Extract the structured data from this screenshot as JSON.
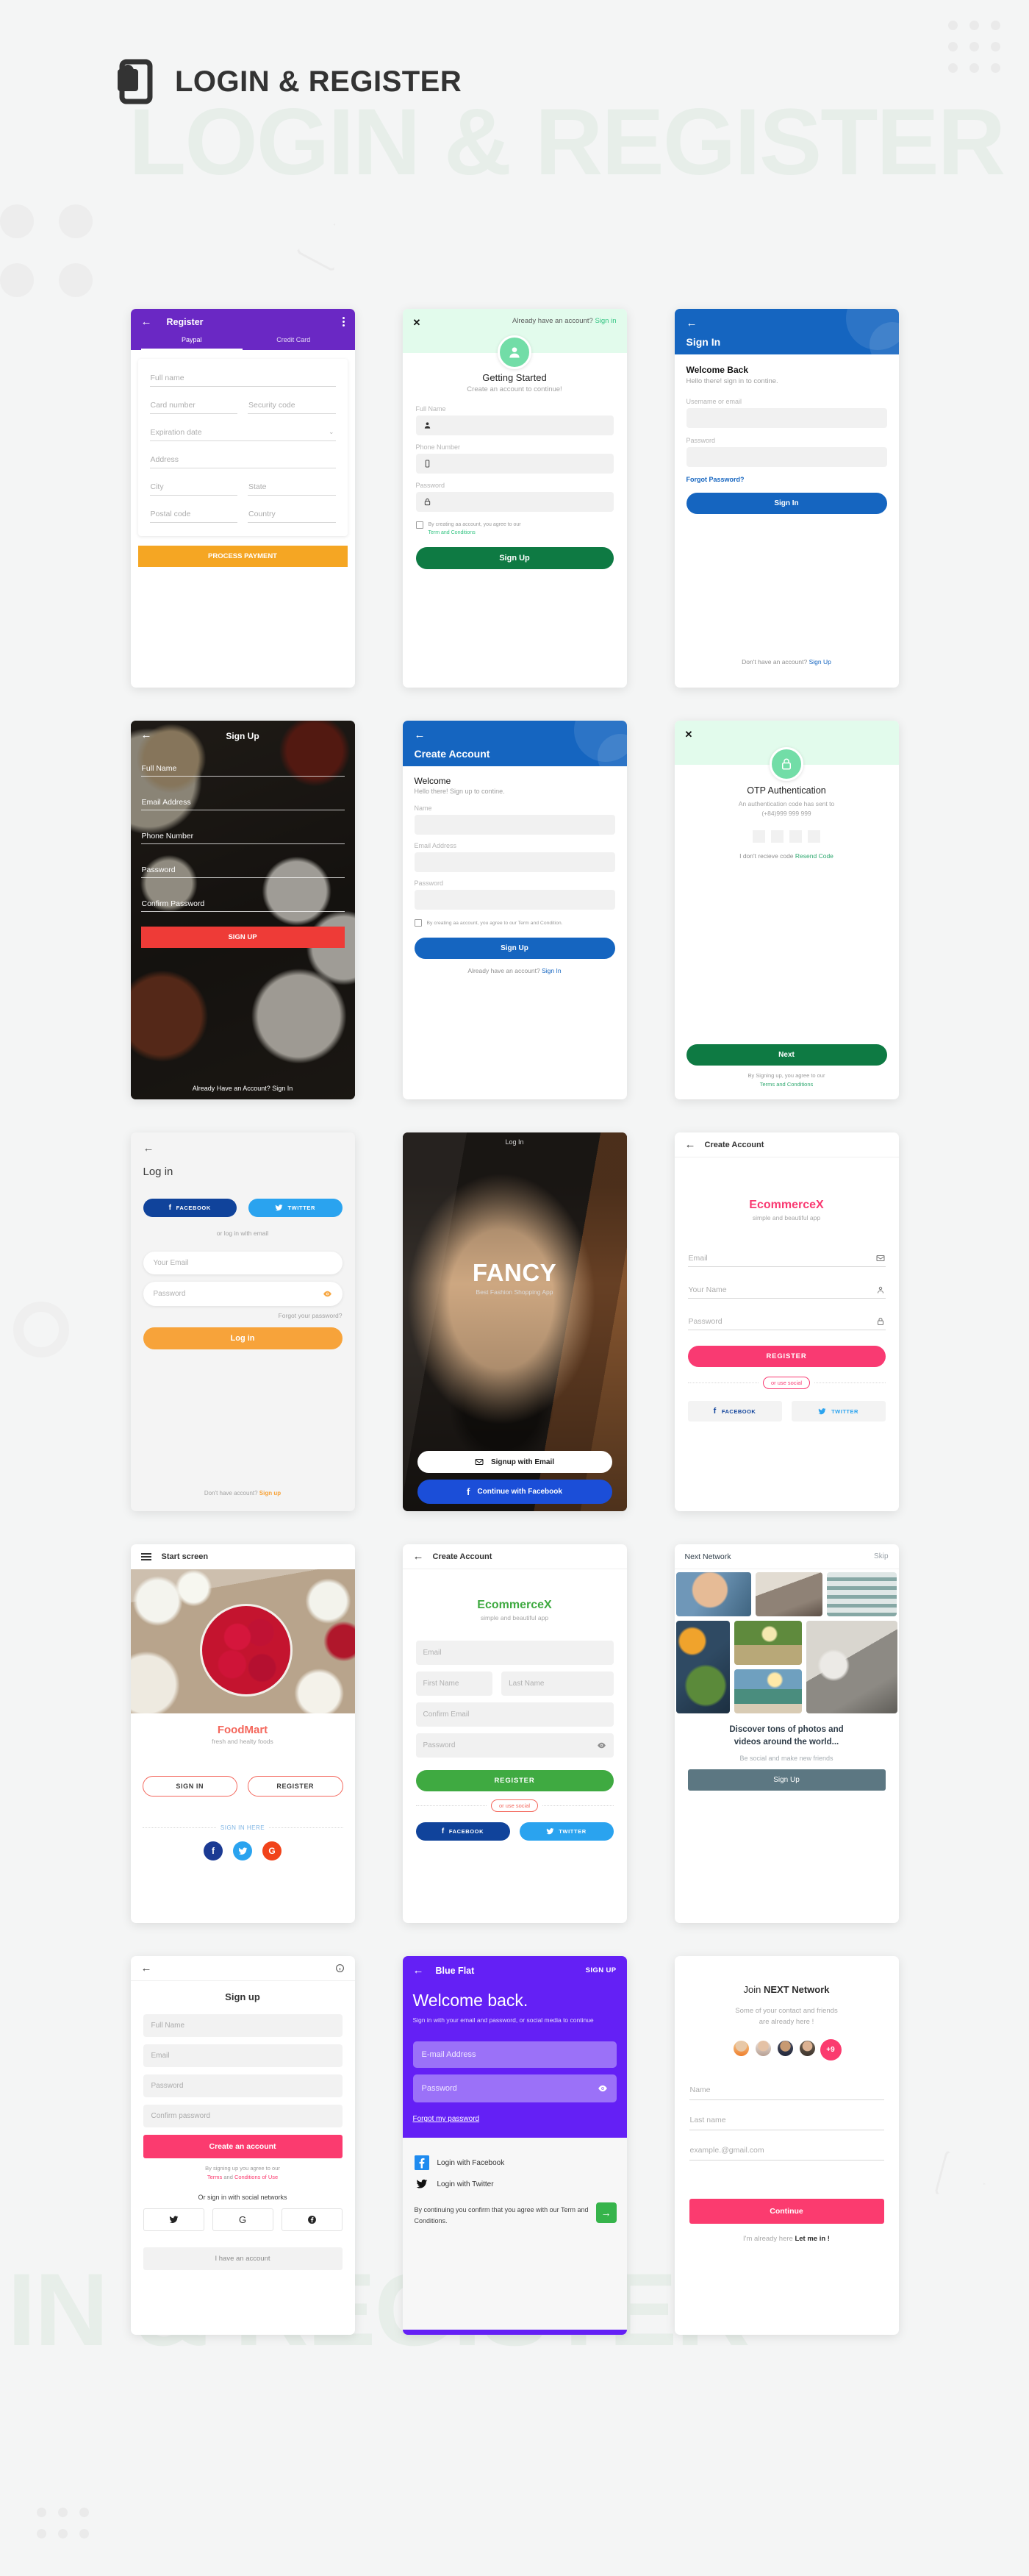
{
  "page": {
    "title": "LOGIN & REGISTER",
    "watermark_top": "LOGIN & REGISTER",
    "watermark_bottom": "IN & REGISTER",
    "header_icon": "phone-lock-icon"
  },
  "screens": [
    {
      "id": "register-payment",
      "appbar": {
        "title": "Register",
        "back": "←",
        "menu": "⋮"
      },
      "tabs": [
        {
          "label": "Paypal",
          "active": true
        },
        {
          "label": "Credit Card",
          "active": false
        }
      ],
      "fields": [
        {
          "label": "Full name"
        },
        {
          "label": "Card number"
        },
        {
          "label": "Security code"
        },
        {
          "label": "Expiration date",
          "dropdown": true
        },
        {
          "label": "Address"
        },
        {
          "label": "City"
        },
        {
          "label": "State"
        },
        {
          "label": "Postal code"
        },
        {
          "label": "Country"
        }
      ],
      "submit": "PROCESS PAYMENT",
      "colors": {
        "header": "#6a28c4",
        "button": "#f5a623"
      }
    },
    {
      "id": "getting-started",
      "close": "✕",
      "top_prompt": "Already have an account?",
      "top_link": "Sign in",
      "avatar_icon": "person-icon",
      "title": "Getting Started",
      "subtitle": "Create an account to continue!",
      "fields": [
        {
          "label": "Full Name",
          "icon": "person-icon"
        },
        {
          "label": "Phone Number",
          "icon": "phone-icon"
        },
        {
          "label": "Password",
          "icon": "lock-icon"
        }
      ],
      "terms_text": "By creating aa account, you agree to our",
      "terms_link": "Term and Conditions",
      "submit": "Sign Up",
      "colors": {
        "header": "#e2fbec",
        "accent": "#72dda7",
        "button": "#0e7a43"
      }
    },
    {
      "id": "sign-in",
      "appbar_title": "Sign In",
      "heading": "Welcome Back",
      "subtitle": "Hello there! sign in to contine.",
      "fields": [
        {
          "label": "Usemame or email"
        },
        {
          "label": "Password"
        }
      ],
      "forgot": "Forgot Password?",
      "submit": "Sign In",
      "footer_text": "Don't have an account?",
      "footer_link": "Sign Up",
      "colors": {
        "header": "#1565c0",
        "button": "#1565c0"
      }
    },
    {
      "id": "signup-food",
      "title": "Sign Up",
      "fields": [
        {
          "label": "Full Name"
        },
        {
          "label": "Email Address"
        },
        {
          "label": "Phone Number"
        },
        {
          "label": "Password"
        },
        {
          "label": "Confirm Password"
        }
      ],
      "submit": "SIGN UP",
      "footer": "Already Have an Account? Sign In",
      "colors": {
        "button": "#ee3b37"
      }
    },
    {
      "id": "create-account-blue",
      "appbar_title": "Create Account",
      "heading": "Welcome",
      "subtitle": "Hello there! Sign up to contine.",
      "fields": [
        {
          "label": "Name"
        },
        {
          "label": "Email Address"
        },
        {
          "label": "Password"
        }
      ],
      "terms": "By creating aa account, you agree to our Term and Condition.",
      "submit": "Sign Up",
      "footer_text": "Already have an account?",
      "footer_link": "Sign In",
      "colors": {
        "header": "#1565c0",
        "button": "#1565c0"
      }
    },
    {
      "id": "otp",
      "close": "✕",
      "lock_icon": "lock-icon",
      "title": "OTP Authentication",
      "subtitle_line1": "An authentication code has sent to",
      "subtitle_line2": "(+84)999 999 999",
      "otp_boxes": 4,
      "resend_text": "I don't recieve code",
      "resend_link": "Resend Code",
      "submit": "Next",
      "footer_text": "By Signing up, you agree to our",
      "footer_link": "Terms and Conditions",
      "colors": {
        "header": "#e2fbec",
        "accent": "#72dda7",
        "button": "#0e7a43"
      }
    },
    {
      "id": "log-in-social",
      "title": "Log in",
      "social": [
        {
          "label": "FACEBOOK",
          "icon": "facebook-icon",
          "color": "#10439b"
        },
        {
          "label": "TWITTER",
          "icon": "twitter-icon",
          "color": "#2aa3ef"
        }
      ],
      "divider": "or log in with email",
      "fields": [
        {
          "label": "Your Email"
        },
        {
          "label": "Password",
          "icon": "eye-icon"
        }
      ],
      "forgot": "Forgot your password?",
      "submit": "Log in",
      "footer_text": "Don't have account?",
      "footer_link": "Sign up",
      "colors": {
        "button": "#f7a33a"
      }
    },
    {
      "id": "fancy",
      "appbar_title": "Log In",
      "brand": "FANCY",
      "tagline": "Best Fashion Shopping App",
      "buttons": [
        {
          "label": "Signup with Email",
          "icon": "envelope-icon"
        },
        {
          "label": "Continue with Facebook",
          "icon": "facebook-icon"
        }
      ]
    },
    {
      "id": "ecommercex-pink",
      "appbar_title": "Create Account",
      "brand": "EcommerceX",
      "tagline": "simple and beautiful app",
      "fields": [
        {
          "label": "Email",
          "icon": "envelope-icon"
        },
        {
          "label": "Your Name",
          "icon": "person-icon"
        },
        {
          "label": "Password",
          "icon": "lock-icon"
        }
      ],
      "submit": "REGISTER",
      "divider": "or use social",
      "social": [
        {
          "label": "FACEBOOK",
          "icon": "facebook-icon",
          "color": "#10439b"
        },
        {
          "label": "TWITTER",
          "icon": "twitter-icon",
          "color": "#2aa3ef"
        }
      ],
      "colors": {
        "brand": "#f93a72",
        "button": "#f93a72"
      }
    },
    {
      "id": "foodmart",
      "appbar_title": "Start screen",
      "menu_icon": "hamburger-icon",
      "brand": "FoodMart",
      "tagline": "fresh and healty foods",
      "buttons": [
        {
          "label": "SIGN IN"
        },
        {
          "label": "REGISTER"
        }
      ],
      "divider": "SIGN IN HERE",
      "social": [
        {
          "icon": "facebook-icon",
          "glyph": "f",
          "color": "#1b3a93"
        },
        {
          "icon": "twitter-icon",
          "glyph": "t",
          "color": "#2aa3ef"
        },
        {
          "icon": "google-icon",
          "glyph": "G",
          "color": "#f1431a"
        }
      ],
      "colors": {
        "brand": "#f4675c"
      }
    },
    {
      "id": "ecommercex-green",
      "appbar_title": "Create Account",
      "brand": "EcommerceX",
      "tagline": "simple and beautiful app",
      "fields": [
        {
          "label": "Email"
        },
        {
          "label": "First Name"
        },
        {
          "label": "Last Name"
        },
        {
          "label": "Confirm Email"
        },
        {
          "label": "Password",
          "icon": "eye-icon"
        }
      ],
      "submit": "REGISTER",
      "divider": "or use social",
      "social": [
        {
          "label": "FACEBOOK",
          "icon": "facebook-icon",
          "color": "#10439b"
        },
        {
          "label": "TWITTER",
          "icon": "twitter-icon",
          "color": "#2aa3ef"
        }
      ],
      "colors": {
        "brand": "#3faa41",
        "button": "#3faa41"
      }
    },
    {
      "id": "next-network-gallery",
      "appbar_title": "Next Network",
      "skip": "Skip",
      "headline_line1": "Discover tons of photos and",
      "headline_line2": "videos around the world...",
      "subtitle": "Be social and make new friends",
      "submit": "Sign Up",
      "colors": {
        "button": "#5c7782"
      }
    },
    {
      "id": "signup-pink",
      "info_icon": "info-icon",
      "title": "Sign up",
      "fields": [
        {
          "label": "Full Name"
        },
        {
          "label": "Email"
        },
        {
          "label": "Password"
        },
        {
          "label": "Confirm password"
        }
      ],
      "submit": "Create an account",
      "terms_line1": "By signing up you agree to our",
      "terms_link1": "Terms",
      "terms_and": " and ",
      "terms_link2": "Conditions of Use",
      "social_divider": "Or sign in with social networks",
      "social": [
        {
          "icon": "twitter-icon",
          "glyph": "🐦"
        },
        {
          "icon": "google-icon",
          "glyph": "G"
        },
        {
          "icon": "facebook-icon",
          "glyph": "f"
        }
      ],
      "have_account": "I have an account",
      "colors": {
        "button": "#fb3b6f",
        "link": "#fb3b6f"
      }
    },
    {
      "id": "blue-flat",
      "appbar_title": "Blue Flat",
      "signup": "SIGN UP",
      "heading": "Welcome back.",
      "subtitle": "Sign in with your email and password, or social media to continue",
      "fields": [
        {
          "label": "E-mail Address"
        },
        {
          "label": "Password",
          "icon": "eye-icon"
        }
      ],
      "forgot": "Forgot my password",
      "fab_icon": "arrow-right-icon",
      "social": [
        {
          "label": "Login with Facebook",
          "icon": "facebook-icon"
        },
        {
          "label": "Login with Twitter",
          "icon": "twitter-icon"
        }
      ],
      "terms": "By continuing you confirm that you agree with our Term and Conditions.",
      "colors": {
        "header": "#6420f5",
        "field": "#9b71f8",
        "fab": "#36b44b"
      }
    },
    {
      "id": "join-next-network",
      "title_prefix": "Join ",
      "title_bold": "NEXT Network",
      "subtitle_line1": "Some of your contact and friends",
      "subtitle_line2": "are already here !",
      "avatar_more": "+9",
      "fields": [
        {
          "label": "Name"
        },
        {
          "label": "Last name"
        },
        {
          "label": "example.@gmail.com"
        }
      ],
      "submit": "Continue",
      "footer_text": "I'm already here",
      "footer_link": "Let me in !",
      "colors": {
        "button": "#fb3b6f"
      }
    }
  ]
}
